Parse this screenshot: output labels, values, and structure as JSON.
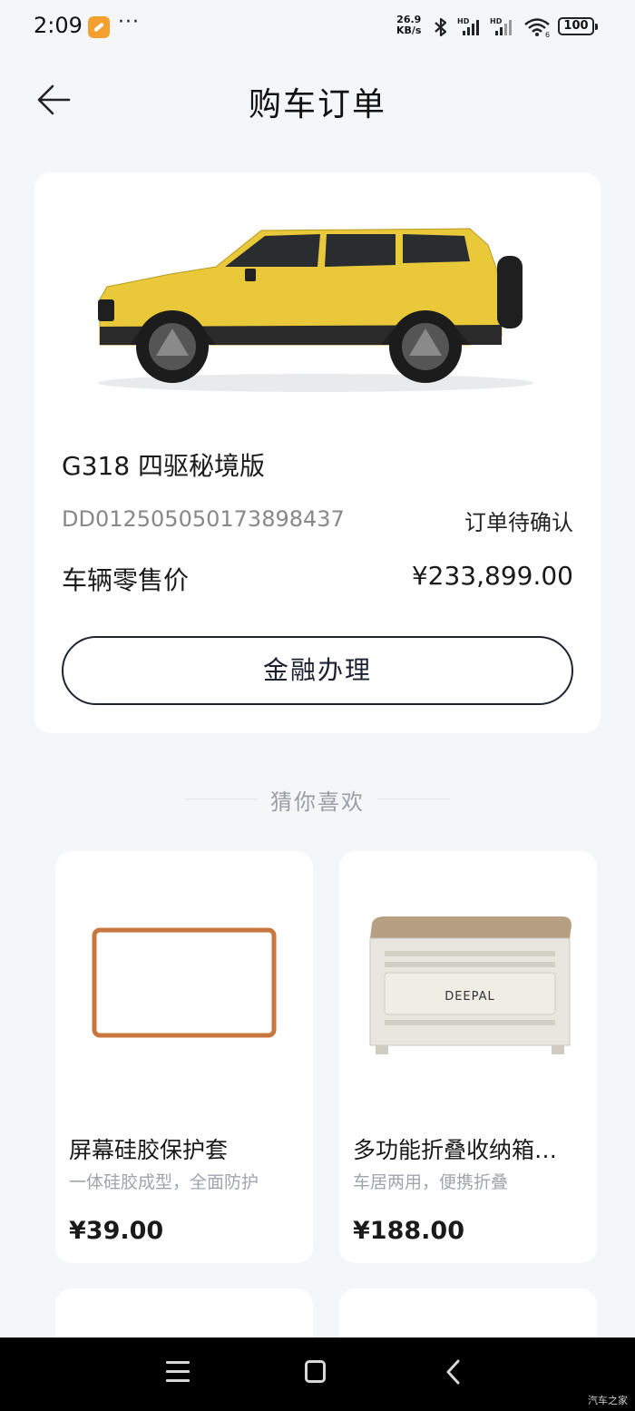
{
  "status_bar": {
    "time": "2:09",
    "dots": "···",
    "speed_top": "26.9",
    "speed_bottom": "KB/s",
    "battery": "100"
  },
  "header": {
    "title": "购车订单",
    "back_icon": "arrow-left-icon"
  },
  "order": {
    "car_name": "G318 四驱秘境版",
    "order_number": "DD012505050173898437",
    "status": "订单待确认",
    "price_label": "车辆零售价",
    "price_value": "¥233,899.00",
    "finance_button": "金融办理",
    "car_color": "#e9c83a"
  },
  "recommend": {
    "title": "猜你喜欢",
    "products": [
      {
        "name": "屏幕硅胶保护套",
        "desc": "一体硅胶成型，全面防护",
        "price": "¥39.00"
      },
      {
        "name": "多功能折叠收纳箱…",
        "desc": "车居两用，便携折叠",
        "price": "¥188.00",
        "logo": "DEEPAL"
      }
    ]
  },
  "watermark": "汽车之家",
  "colors": {
    "background": "#f5f6f8",
    "card": "#ffffff",
    "button_border": "#1e2433",
    "muted_text": "#888888",
    "protector_frame": "#c8773f"
  }
}
